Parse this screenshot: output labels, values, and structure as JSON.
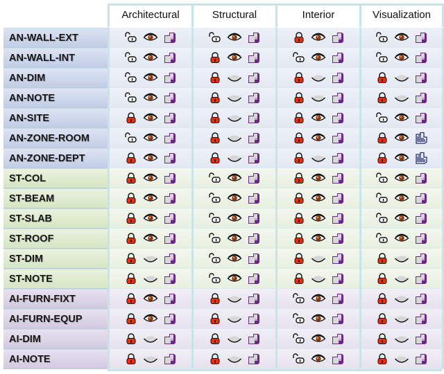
{
  "columns": [
    "Architectural",
    "Structural",
    "Interior",
    "Visualization"
  ],
  "colors": {
    "grid_border": "#c7e4e8",
    "lock_closed": "#e8300c",
    "eye_iris": "#8a3a10",
    "plot_purple": "#6a2a84",
    "plot_alt_blue": "#24306e"
  },
  "rows": [
    {
      "name": "AN-WALL-EXT",
      "group": "an",
      "cells": [
        {
          "lock": "unlocked",
          "visible": true,
          "plot": "normal"
        },
        {
          "lock": "unlocked",
          "visible": true,
          "plot": "normal"
        },
        {
          "lock": "locked",
          "visible": true,
          "plot": "normal"
        },
        {
          "lock": "unlocked",
          "visible": true,
          "plot": "normal"
        }
      ]
    },
    {
      "name": "AN-WALL-INT",
      "group": "an",
      "cells": [
        {
          "lock": "unlocked",
          "visible": true,
          "plot": "normal"
        },
        {
          "lock": "locked",
          "visible": true,
          "plot": "normal"
        },
        {
          "lock": "unlocked",
          "visible": true,
          "plot": "normal"
        },
        {
          "lock": "unlocked",
          "visible": true,
          "plot": "normal"
        }
      ]
    },
    {
      "name": "AN-DIM",
      "group": "an",
      "cells": [
        {
          "lock": "unlocked",
          "visible": true,
          "plot": "normal"
        },
        {
          "lock": "locked",
          "visible": false,
          "plot": "normal"
        },
        {
          "lock": "locked",
          "visible": false,
          "plot": "normal"
        },
        {
          "lock": "locked",
          "visible": false,
          "plot": "normal"
        }
      ]
    },
    {
      "name": "AN-NOTE",
      "group": "an",
      "cells": [
        {
          "lock": "unlocked",
          "visible": true,
          "plot": "normal"
        },
        {
          "lock": "locked",
          "visible": false,
          "plot": "normal"
        },
        {
          "lock": "locked",
          "visible": false,
          "plot": "normal"
        },
        {
          "lock": "locked",
          "visible": false,
          "plot": "normal"
        }
      ]
    },
    {
      "name": "AN-SITE",
      "group": "an",
      "cells": [
        {
          "lock": "locked",
          "visible": true,
          "plot": "normal"
        },
        {
          "lock": "locked",
          "visible": false,
          "plot": "normal"
        },
        {
          "lock": "locked",
          "visible": true,
          "plot": "normal"
        },
        {
          "lock": "unlocked",
          "visible": true,
          "plot": "normal"
        }
      ]
    },
    {
      "name": "AN-ZONE-ROOM",
      "group": "an",
      "cells": [
        {
          "lock": "unlocked",
          "visible": true,
          "plot": "normal"
        },
        {
          "lock": "locked",
          "visible": false,
          "plot": "normal"
        },
        {
          "lock": "locked",
          "visible": true,
          "plot": "normal"
        },
        {
          "lock": "locked",
          "visible": true,
          "plot": "alt"
        }
      ]
    },
    {
      "name": "AN-ZONE-DEPT",
      "group": "an",
      "cells": [
        {
          "lock": "locked",
          "visible": true,
          "plot": "normal"
        },
        {
          "lock": "locked",
          "visible": false,
          "plot": "normal"
        },
        {
          "lock": "locked",
          "visible": false,
          "plot": "normal"
        },
        {
          "lock": "locked",
          "visible": true,
          "plot": "alt"
        }
      ]
    },
    {
      "name": "ST-COL",
      "group": "st",
      "cells": [
        {
          "lock": "locked",
          "visible": true,
          "plot": "normal"
        },
        {
          "lock": "unlocked",
          "visible": true,
          "plot": "normal"
        },
        {
          "lock": "locked",
          "visible": true,
          "plot": "normal"
        },
        {
          "lock": "unlocked",
          "visible": true,
          "plot": "normal"
        }
      ]
    },
    {
      "name": "ST-BEAM",
      "group": "st",
      "cells": [
        {
          "lock": "locked",
          "visible": true,
          "plot": "normal"
        },
        {
          "lock": "unlocked",
          "visible": true,
          "plot": "normal"
        },
        {
          "lock": "locked",
          "visible": true,
          "plot": "normal"
        },
        {
          "lock": "unlocked",
          "visible": true,
          "plot": "normal"
        }
      ]
    },
    {
      "name": "ST-SLAB",
      "group": "st",
      "cells": [
        {
          "lock": "locked",
          "visible": true,
          "plot": "normal"
        },
        {
          "lock": "unlocked",
          "visible": true,
          "plot": "normal"
        },
        {
          "lock": "locked",
          "visible": true,
          "plot": "normal"
        },
        {
          "lock": "unlocked",
          "visible": true,
          "plot": "normal"
        }
      ]
    },
    {
      "name": "ST-ROOF",
      "group": "st",
      "cells": [
        {
          "lock": "locked",
          "visible": true,
          "plot": "normal"
        },
        {
          "lock": "unlocked",
          "visible": true,
          "plot": "normal"
        },
        {
          "lock": "locked",
          "visible": true,
          "plot": "normal"
        },
        {
          "lock": "unlocked",
          "visible": true,
          "plot": "normal"
        }
      ]
    },
    {
      "name": "ST-DIM",
      "group": "st",
      "cells": [
        {
          "lock": "locked",
          "visible": false,
          "plot": "normal"
        },
        {
          "lock": "unlocked",
          "visible": true,
          "plot": "normal"
        },
        {
          "lock": "locked",
          "visible": false,
          "plot": "normal"
        },
        {
          "lock": "locked",
          "visible": false,
          "plot": "normal"
        }
      ]
    },
    {
      "name": "ST-NOTE",
      "group": "st",
      "cells": [
        {
          "lock": "locked",
          "visible": false,
          "plot": "normal"
        },
        {
          "lock": "unlocked",
          "visible": true,
          "plot": "normal"
        },
        {
          "lock": "locked",
          "visible": false,
          "plot": "normal"
        },
        {
          "lock": "locked",
          "visible": false,
          "plot": "normal"
        }
      ]
    },
    {
      "name": "AI-FURN-FIXT",
      "group": "ai",
      "cells": [
        {
          "lock": "locked",
          "visible": true,
          "plot": "normal"
        },
        {
          "lock": "locked",
          "visible": false,
          "plot": "normal"
        },
        {
          "lock": "unlocked",
          "visible": true,
          "plot": "normal"
        },
        {
          "lock": "locked",
          "visible": false,
          "plot": "normal"
        }
      ]
    },
    {
      "name": "AI-FURN-EQUP",
      "group": "ai",
      "cells": [
        {
          "lock": "locked",
          "visible": true,
          "plot": "normal"
        },
        {
          "lock": "locked",
          "visible": false,
          "plot": "normal"
        },
        {
          "lock": "unlocked",
          "visible": true,
          "plot": "normal"
        },
        {
          "lock": "locked",
          "visible": false,
          "plot": "normal"
        }
      ]
    },
    {
      "name": "AI-DIM",
      "group": "ai",
      "cells": [
        {
          "lock": "locked",
          "visible": false,
          "plot": "normal"
        },
        {
          "lock": "locked",
          "visible": false,
          "plot": "normal"
        },
        {
          "lock": "unlocked",
          "visible": true,
          "plot": "normal"
        },
        {
          "lock": "locked",
          "visible": false,
          "plot": "normal"
        }
      ]
    },
    {
      "name": "AI-NOTE",
      "group": "ai",
      "cells": [
        {
          "lock": "locked",
          "visible": false,
          "plot": "normal"
        },
        {
          "lock": "locked",
          "visible": false,
          "plot": "normal"
        },
        {
          "lock": "unlocked",
          "visible": true,
          "plot": "normal"
        },
        {
          "lock": "locked",
          "visible": false,
          "plot": "normal"
        }
      ]
    }
  ]
}
